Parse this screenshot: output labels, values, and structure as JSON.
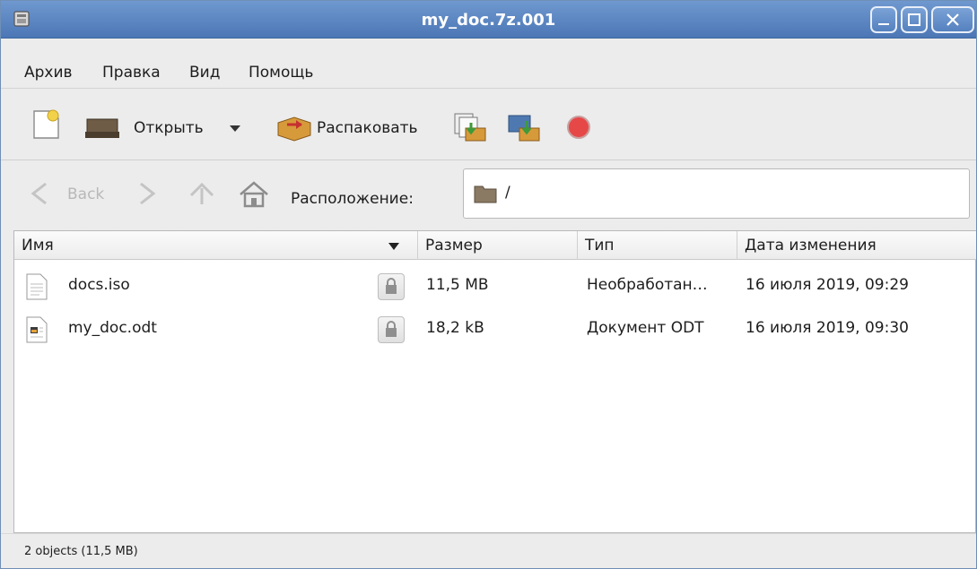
{
  "window": {
    "title": "my_doc.7z.001"
  },
  "menu": [
    "Архив",
    "Правка",
    "Вид",
    "Помощь"
  ],
  "toolbar": {
    "open_label": "Открыть",
    "extract_label": "Распаковать"
  },
  "location": {
    "back_label": "Back",
    "location_label": "Расположение:",
    "path": "/"
  },
  "columns": {
    "name": "Имя",
    "size": "Размер",
    "type": "Тип",
    "modified": "Дата изменения"
  },
  "files": [
    {
      "name": "docs.iso",
      "size": "11,5 MB",
      "type": "Необработан…",
      "modified": "16 июля 2019, 09:29",
      "icon": "text-file-icon"
    },
    {
      "name": "my_doc.odt",
      "size": "18,2 kB",
      "type": "Документ ODT",
      "modified": "16 июля 2019, 09:30",
      "icon": "odt-document-icon"
    }
  ],
  "status": {
    "text": "2 objects (11,5 MB)"
  },
  "colors": {
    "titlebar": "#5a86c2",
    "accent_stop": "#e64848",
    "folder": "#7a6a55"
  }
}
